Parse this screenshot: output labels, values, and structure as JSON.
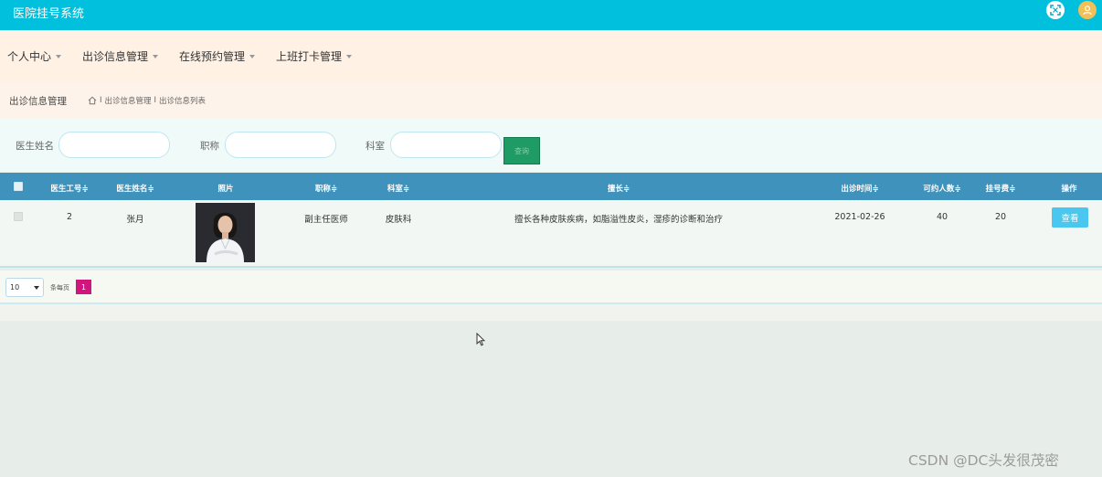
{
  "header": {
    "app_title": "医院挂号系统",
    "fullscreen_icon": "fullscreen-icon",
    "avatar_icon": "user-icon"
  },
  "nav": {
    "items": [
      {
        "label": "个人中心"
      },
      {
        "label": "出诊信息管理"
      },
      {
        "label": "在线预约管理"
      },
      {
        "label": "上班打卡管理"
      }
    ]
  },
  "breadcrumb": {
    "title": "出诊信息管理",
    "trail": [
      "出诊信息管理",
      "出诊信息列表"
    ],
    "separator": "I"
  },
  "search": {
    "doctor_name_label": "医生姓名",
    "title_label": "职称",
    "department_label": "科室",
    "button_label": "查询"
  },
  "table": {
    "columns": [
      "医生工号",
      "医生姓名",
      "照片",
      "职称",
      "科室",
      "擅长",
      "出诊时间",
      "可约人数",
      "挂号费",
      "操作"
    ],
    "sortable_mark": "≑",
    "rows": [
      {
        "doctor_id": "2",
        "doctor_name": "张月",
        "title": "副主任医师",
        "department": "皮肤科",
        "specialty": "擅长各种皮肤疾病，如脂溢性皮炎，湿疹的诊断和治疗",
        "visit_date": "2021-02-26",
        "capacity": "40",
        "fee": "20",
        "action_label": "查看"
      }
    ]
  },
  "pagination": {
    "page_size": "10",
    "per_page_label": "条每页",
    "current_page": "1"
  },
  "watermark": "CSDN @DC头发很茂密",
  "colors": {
    "topbar": "#00c0de",
    "table_header": "#3f92bc",
    "view_button": "#49c7ee",
    "page_active": "#d0157f"
  }
}
